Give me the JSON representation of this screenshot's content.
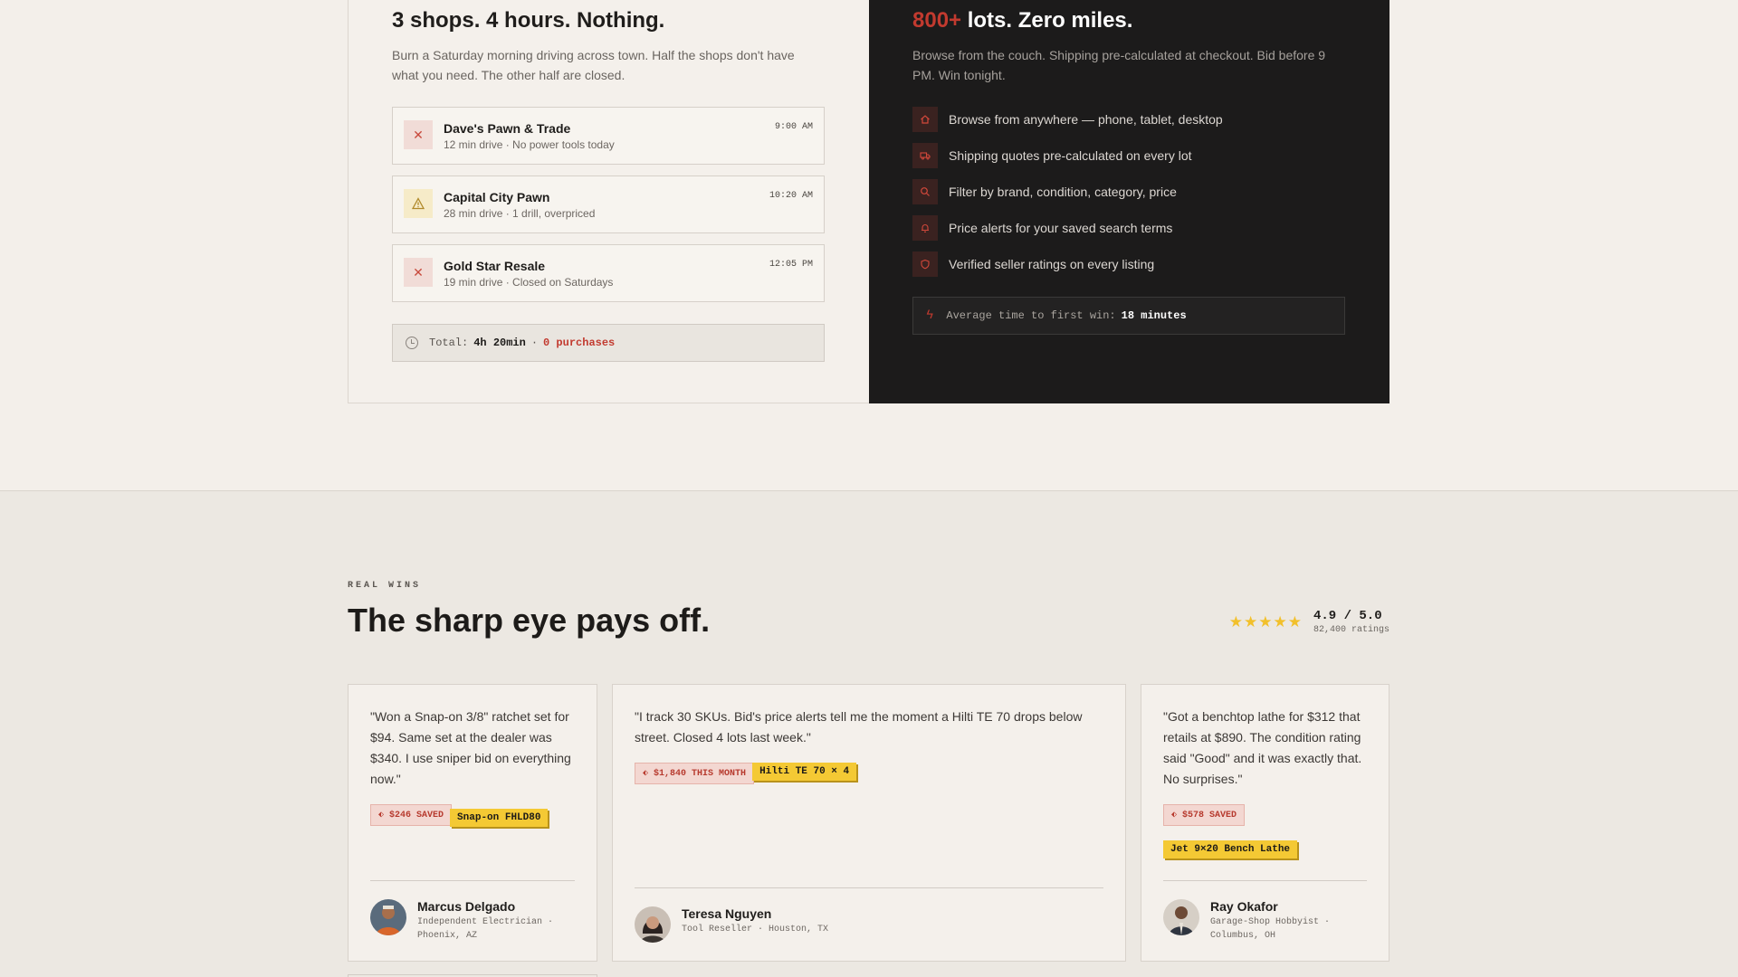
{
  "comparison": {
    "left": {
      "title": "3 shops. 4 hours. Nothing.",
      "subtitle": "Burn a Saturday morning driving across town. Half the shops don't have what you need. The other half are closed.",
      "shops": [
        {
          "name": "Dave's Pawn & Trade",
          "meta": "12 min drive · No power tools today",
          "time": "9:00 AM",
          "status_icon": "x-icon"
        },
        {
          "name": "Capital City Pawn",
          "meta": "28 min drive · 1 drill, overpriced",
          "time": "10:20 AM",
          "status_icon": "warning-icon"
        },
        {
          "name": "Gold Star Resale",
          "meta": "19 min drive · Closed on Saturdays",
          "time": "12:05 PM",
          "status_icon": "x-icon"
        }
      ],
      "total": {
        "label": "Total:",
        "duration": "4h 20min",
        "separator": "·",
        "purchases": "0 purchases"
      }
    },
    "right": {
      "title_accent": "800+",
      "title_rest": " lots. Zero miles.",
      "subtitle": "Browse from the couch. Shipping pre-calculated at checkout. Bid before 9 PM. Win tonight.",
      "features": [
        {
          "icon": "home-icon",
          "text": "Browse from anywhere — phone, tablet, desktop"
        },
        {
          "icon": "truck-icon",
          "text": "Shipping quotes pre-calculated on every lot"
        },
        {
          "icon": "search-icon",
          "text": "Filter by brand, condition, category, price"
        },
        {
          "icon": "bell-icon",
          "text": "Price alerts for your saved search terms"
        },
        {
          "icon": "shield-icon",
          "text": "Verified seller ratings on every listing"
        }
      ],
      "average": {
        "label": "Average time to first win:",
        "value": "18 minutes"
      }
    }
  },
  "wins": {
    "eyebrow": "REAL WINS",
    "title": "The sharp eye pays off.",
    "rating": {
      "stars": "★★★★★",
      "score": "4.9 / 5.0",
      "count": "82,400 ratings",
      "star_color": "#f2c02b"
    },
    "testimonials": [
      {
        "quote": "\"Won a Snap-on 3/8\" ratchet set for $94. Same set at the dealer was $340. I use sniper bid on everything now.\"",
        "saved": "$246 SAVED",
        "product": "Snap-on FHLD80",
        "name": "Marcus Delgado",
        "role": "Independent Electrician · Phoenix, AZ"
      },
      {
        "quote": "\"I track 30 SKUs. Bid's price alerts tell me the moment a Hilti TE 70 drops below street. Closed 4 lots last week.\"",
        "saved": "$1,840 THIS MONTH",
        "product": "Hilti TE 70 × 4",
        "name": "Teresa Nguyen",
        "role": "Tool Reseller · Houston, TX"
      },
      {
        "quote": "\"Got a benchtop lathe for $312 that retails at $890. The condition rating said \"Good\" and it was exactly that. No surprises.\"",
        "saved": "$578 SAVED",
        "product": "Jet 9×20 Bench Lathe",
        "name": "Ray Okafor",
        "role": "Garage-Shop Hobbyist · Columbus, OH"
      }
    ]
  },
  "colors": {
    "accent_red": "#c23a2f",
    "tag_yellow": "#f4c934",
    "dark_panel": "#1c1b1b"
  }
}
